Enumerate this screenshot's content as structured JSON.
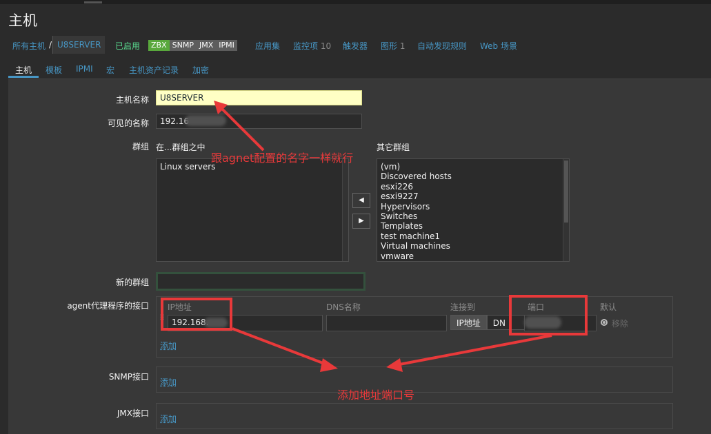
{
  "page": {
    "title": "主机"
  },
  "nav": {
    "all_hosts": "所有主机",
    "separator": "/",
    "current_host": "U8SERVER",
    "status": "已启用",
    "availability": [
      "ZBX",
      "SNMP",
      "JMX",
      "IPMI"
    ],
    "links": [
      {
        "label": "应用集",
        "count": ""
      },
      {
        "label": "监控项",
        "count": "10"
      },
      {
        "label": "触发器",
        "count": ""
      },
      {
        "label": "图形",
        "count": "1"
      },
      {
        "label": "自动发现规则",
        "count": ""
      },
      {
        "label": "Web 场景",
        "count": ""
      }
    ]
  },
  "tabs": [
    "主机",
    "模板",
    "IPMI",
    "宏",
    "主机资产记录",
    "加密"
  ],
  "form": {
    "host_name_label": "主机名称",
    "host_name_value": "U8SERVER",
    "visible_name_label": "可见的名称",
    "visible_name_value": "192.16",
    "groups_label": "群组",
    "in_groups_label": "在...群组之中",
    "in_groups": [
      "Linux servers"
    ],
    "other_groups_label": "其它群组",
    "other_groups": [
      "(vm)",
      "Discovered hosts",
      "esxi226",
      "esxi9227",
      "Hypervisors",
      "Switches",
      "Templates",
      "test machine1",
      "Virtual machines",
      "vmware"
    ],
    "new_group_label": "新的群组",
    "new_group_value": "",
    "agent_iface_label": "agent代理程序的接口",
    "iface_cols": {
      "ip": "IP地址",
      "dns": "DNS名称",
      "connect": "连接到",
      "port": "端口",
      "default": "默认"
    },
    "iface_ip_value": "192.168.",
    "iface_dns_value": "",
    "connect_ip": "IP地址",
    "connect_dns": "DN",
    "iface_remove": "移除",
    "add_label": "添加",
    "snmp_label": "SNMP接口",
    "jmx_label": "JMX接口"
  },
  "annotations": {
    "name_note": "跟agnet配置的名字一样就行",
    "iface_note": "添加地址端口号",
    "color": "#e8393a"
  }
}
